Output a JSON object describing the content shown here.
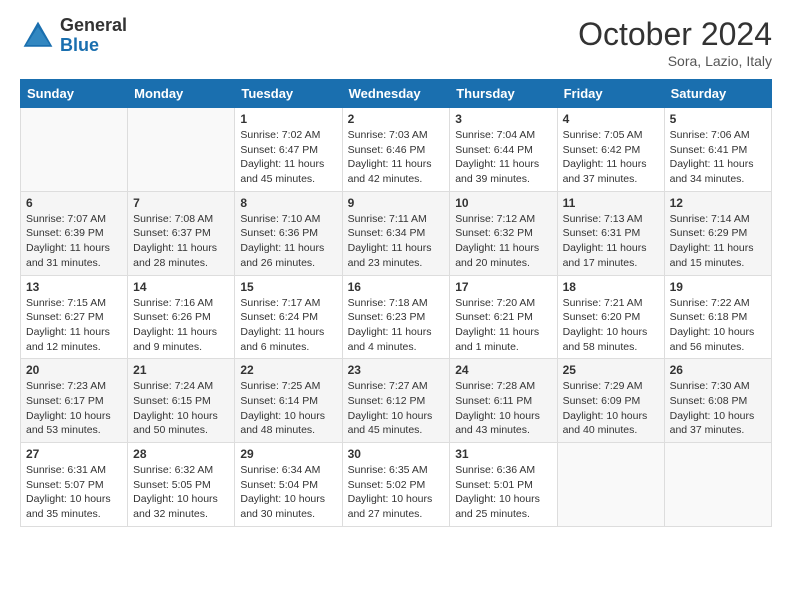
{
  "header": {
    "logo_general": "General",
    "logo_blue": "Blue",
    "month_title": "October 2024",
    "location": "Sora, Lazio, Italy"
  },
  "weekdays": [
    "Sunday",
    "Monday",
    "Tuesday",
    "Wednesday",
    "Thursday",
    "Friday",
    "Saturday"
  ],
  "weeks": [
    [
      {
        "day": "",
        "info": ""
      },
      {
        "day": "",
        "info": ""
      },
      {
        "day": "1",
        "info": "Sunrise: 7:02 AM\nSunset: 6:47 PM\nDaylight: 11 hours and 45 minutes."
      },
      {
        "day": "2",
        "info": "Sunrise: 7:03 AM\nSunset: 6:46 PM\nDaylight: 11 hours and 42 minutes."
      },
      {
        "day": "3",
        "info": "Sunrise: 7:04 AM\nSunset: 6:44 PM\nDaylight: 11 hours and 39 minutes."
      },
      {
        "day": "4",
        "info": "Sunrise: 7:05 AM\nSunset: 6:42 PM\nDaylight: 11 hours and 37 minutes."
      },
      {
        "day": "5",
        "info": "Sunrise: 7:06 AM\nSunset: 6:41 PM\nDaylight: 11 hours and 34 minutes."
      }
    ],
    [
      {
        "day": "6",
        "info": "Sunrise: 7:07 AM\nSunset: 6:39 PM\nDaylight: 11 hours and 31 minutes."
      },
      {
        "day": "7",
        "info": "Sunrise: 7:08 AM\nSunset: 6:37 PM\nDaylight: 11 hours and 28 minutes."
      },
      {
        "day": "8",
        "info": "Sunrise: 7:10 AM\nSunset: 6:36 PM\nDaylight: 11 hours and 26 minutes."
      },
      {
        "day": "9",
        "info": "Sunrise: 7:11 AM\nSunset: 6:34 PM\nDaylight: 11 hours and 23 minutes."
      },
      {
        "day": "10",
        "info": "Sunrise: 7:12 AM\nSunset: 6:32 PM\nDaylight: 11 hours and 20 minutes."
      },
      {
        "day": "11",
        "info": "Sunrise: 7:13 AM\nSunset: 6:31 PM\nDaylight: 11 hours and 17 minutes."
      },
      {
        "day": "12",
        "info": "Sunrise: 7:14 AM\nSunset: 6:29 PM\nDaylight: 11 hours and 15 minutes."
      }
    ],
    [
      {
        "day": "13",
        "info": "Sunrise: 7:15 AM\nSunset: 6:27 PM\nDaylight: 11 hours and 12 minutes."
      },
      {
        "day": "14",
        "info": "Sunrise: 7:16 AM\nSunset: 6:26 PM\nDaylight: 11 hours and 9 minutes."
      },
      {
        "day": "15",
        "info": "Sunrise: 7:17 AM\nSunset: 6:24 PM\nDaylight: 11 hours and 6 minutes."
      },
      {
        "day": "16",
        "info": "Sunrise: 7:18 AM\nSunset: 6:23 PM\nDaylight: 11 hours and 4 minutes."
      },
      {
        "day": "17",
        "info": "Sunrise: 7:20 AM\nSunset: 6:21 PM\nDaylight: 11 hours and 1 minute."
      },
      {
        "day": "18",
        "info": "Sunrise: 7:21 AM\nSunset: 6:20 PM\nDaylight: 10 hours and 58 minutes."
      },
      {
        "day": "19",
        "info": "Sunrise: 7:22 AM\nSunset: 6:18 PM\nDaylight: 10 hours and 56 minutes."
      }
    ],
    [
      {
        "day": "20",
        "info": "Sunrise: 7:23 AM\nSunset: 6:17 PM\nDaylight: 10 hours and 53 minutes."
      },
      {
        "day": "21",
        "info": "Sunrise: 7:24 AM\nSunset: 6:15 PM\nDaylight: 10 hours and 50 minutes."
      },
      {
        "day": "22",
        "info": "Sunrise: 7:25 AM\nSunset: 6:14 PM\nDaylight: 10 hours and 48 minutes."
      },
      {
        "day": "23",
        "info": "Sunrise: 7:27 AM\nSunset: 6:12 PM\nDaylight: 10 hours and 45 minutes."
      },
      {
        "day": "24",
        "info": "Sunrise: 7:28 AM\nSunset: 6:11 PM\nDaylight: 10 hours and 43 minutes."
      },
      {
        "day": "25",
        "info": "Sunrise: 7:29 AM\nSunset: 6:09 PM\nDaylight: 10 hours and 40 minutes."
      },
      {
        "day": "26",
        "info": "Sunrise: 7:30 AM\nSunset: 6:08 PM\nDaylight: 10 hours and 37 minutes."
      }
    ],
    [
      {
        "day": "27",
        "info": "Sunrise: 6:31 AM\nSunset: 5:07 PM\nDaylight: 10 hours and 35 minutes."
      },
      {
        "day": "28",
        "info": "Sunrise: 6:32 AM\nSunset: 5:05 PM\nDaylight: 10 hours and 32 minutes."
      },
      {
        "day": "29",
        "info": "Sunrise: 6:34 AM\nSunset: 5:04 PM\nDaylight: 10 hours and 30 minutes."
      },
      {
        "day": "30",
        "info": "Sunrise: 6:35 AM\nSunset: 5:02 PM\nDaylight: 10 hours and 27 minutes."
      },
      {
        "day": "31",
        "info": "Sunrise: 6:36 AM\nSunset: 5:01 PM\nDaylight: 10 hours and 25 minutes."
      },
      {
        "day": "",
        "info": ""
      },
      {
        "day": "",
        "info": ""
      }
    ]
  ]
}
